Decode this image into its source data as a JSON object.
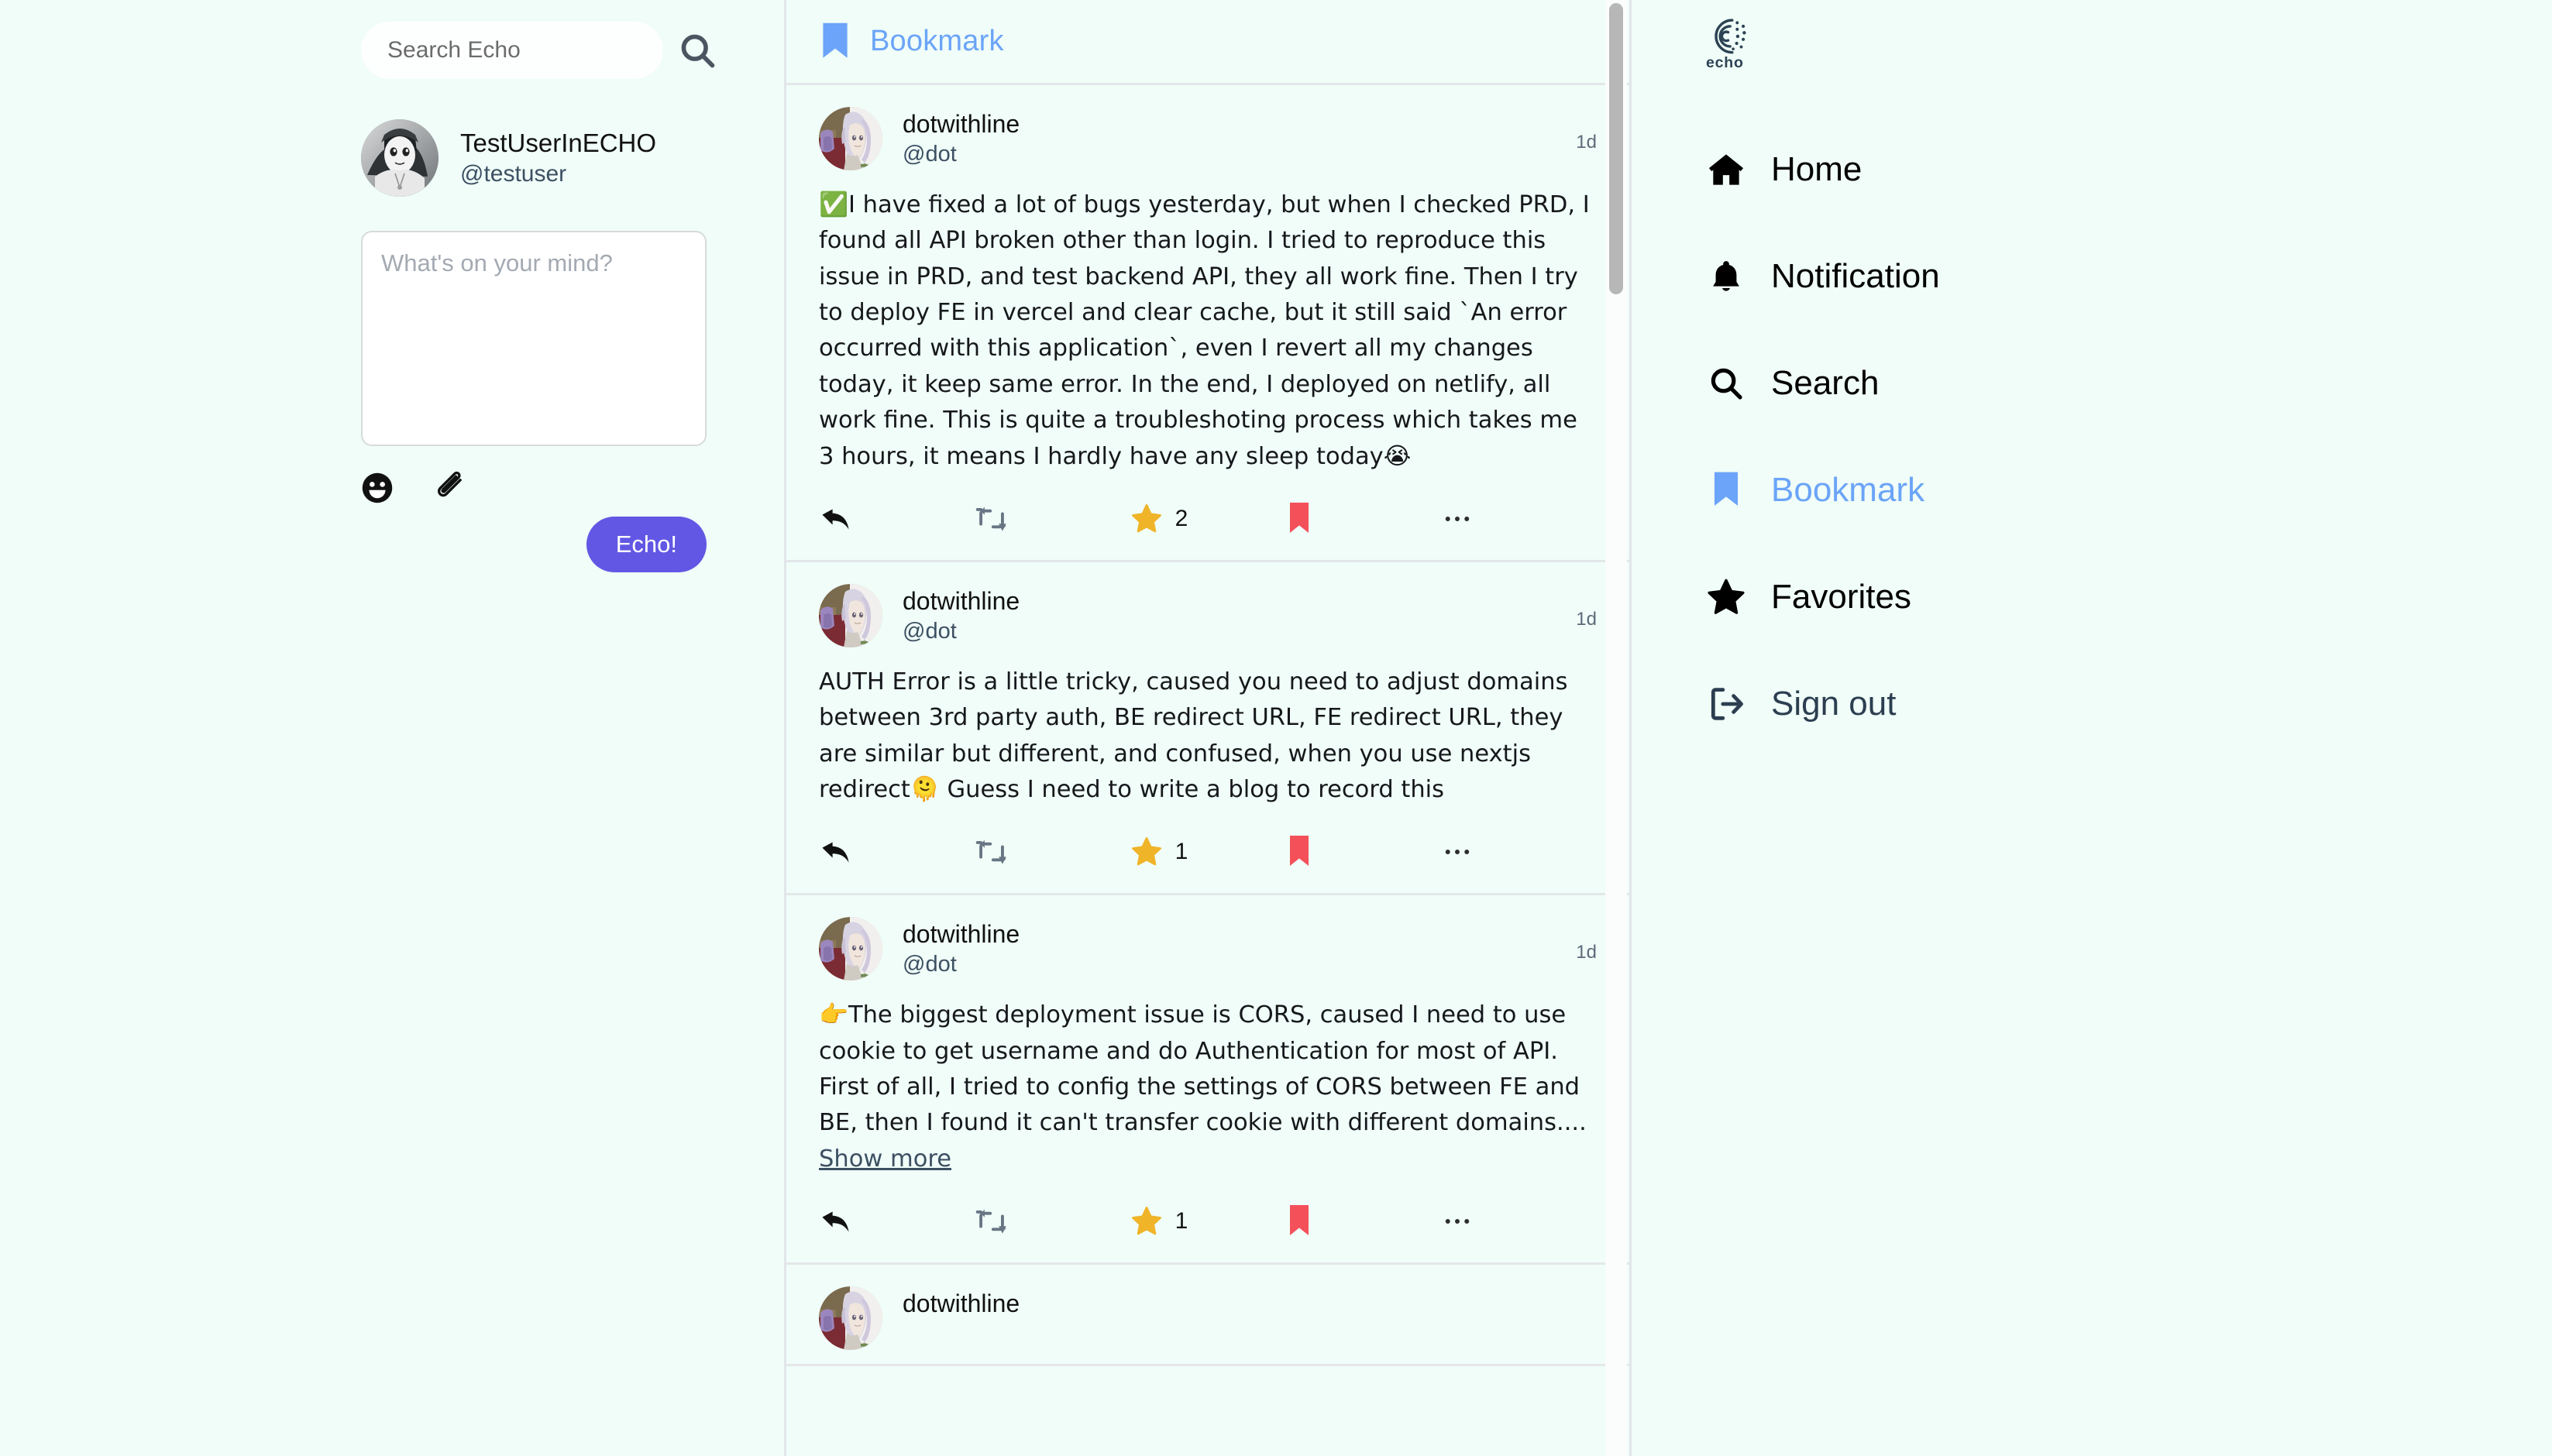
{
  "app": {
    "brand_name": "echo",
    "background": "#f0fdf8",
    "accent_blue": "#6ba4f8",
    "accent_purple": "#6257e4",
    "star_gold": "#f0b429",
    "bookmark_red": "#f4505a"
  },
  "search": {
    "placeholder": "Search Echo",
    "value": "",
    "icon": "search-icon"
  },
  "profile": {
    "display_name": "TestUserInECHO",
    "handle": "@testuser",
    "avatar": "avatar-testuser"
  },
  "compose": {
    "placeholder": "What's on your mind?",
    "value": "",
    "emoji_icon": "emoji-smiley-icon",
    "attach_icon": "paperclip-icon",
    "submit_label": "Echo!"
  },
  "feed": {
    "header": {
      "icon": "bookmark-icon",
      "title": "Bookmark"
    },
    "posts": [
      {
        "display_name": "dotwithline",
        "handle": "@dot",
        "time": "1d",
        "body": "✅I have fixed a lot of bugs yesterday, but when I checked PRD, I found all API broken other than login. I tried to reproduce this issue in PRD, and test backend API, they all work fine. Then I try to deploy FE in vercel and clear cache, but it still said `An error occurred with this application`, even I revert all my changes today, it keep same error. In the end, I deployed on netlify, all work fine. This is quite a troubleshoting process which takes me 3 hours, it means I hardly have any sleep today😭",
        "show_more": "",
        "reply_icon": "reply-icon",
        "repost_icon": "repost-icon",
        "star_icon": "star-icon",
        "star_count": "2",
        "bookmark_icon": "bookmark-filled-icon",
        "more_icon": "ellipsis-icon"
      },
      {
        "display_name": "dotwithline",
        "handle": "@dot",
        "time": "1d",
        "body": "AUTH Error is a little tricky, caused you need to adjust domains between 3rd party auth, BE redirect URL, FE redirect URL, they are similar but different, and confused, when you use nextjs redirect🫠 Guess I need to write a blog to record this",
        "show_more": "",
        "reply_icon": "reply-icon",
        "repost_icon": "repost-icon",
        "star_icon": "star-icon",
        "star_count": "1",
        "bookmark_icon": "bookmark-filled-icon",
        "more_icon": "ellipsis-icon"
      },
      {
        "display_name": "dotwithline",
        "handle": "@dot",
        "time": "1d",
        "body": "👉The biggest deployment issue is CORS, caused I need to use cookie to get username and do Authentication for most of API. First of all, I tried to config the settings of CORS between FE and BE, then I found it can't transfer cookie with different domains.... ",
        "show_more": "Show more",
        "reply_icon": "reply-icon",
        "repost_icon": "repost-icon",
        "star_icon": "star-icon",
        "star_count": "1",
        "bookmark_icon": "bookmark-filled-icon",
        "more_icon": "ellipsis-icon"
      },
      {
        "display_name": "dotwithline",
        "handle": "",
        "time": "",
        "body": "",
        "show_more": "",
        "reply_icon": "reply-icon",
        "repost_icon": "repost-icon",
        "star_icon": "star-icon",
        "star_count": "",
        "bookmark_icon": "bookmark-filled-icon",
        "more_icon": "ellipsis-icon"
      }
    ]
  },
  "nav": {
    "items": [
      {
        "label": "Home",
        "icon": "home-icon",
        "active": false
      },
      {
        "label": "Notification",
        "icon": "bell-icon",
        "active": false
      },
      {
        "label": "Search",
        "icon": "search-icon",
        "active": false
      },
      {
        "label": "Bookmark",
        "icon": "bookmark-icon",
        "active": true
      },
      {
        "label": "Favorites",
        "icon": "star-icon",
        "active": false
      },
      {
        "label": "Sign out",
        "icon": "sign-out-icon",
        "active": false
      }
    ]
  }
}
